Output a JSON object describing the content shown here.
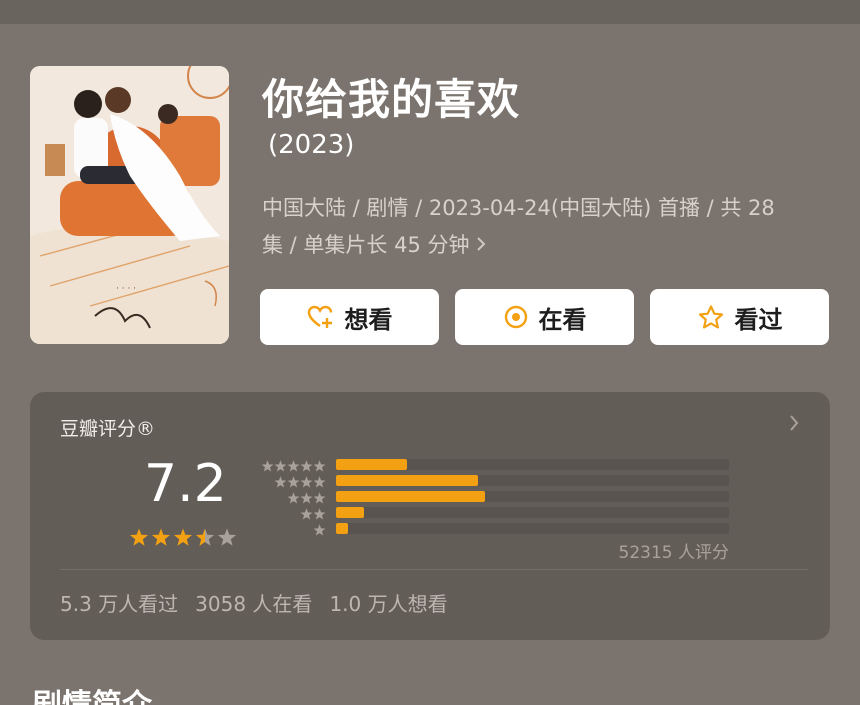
{
  "movie": {
    "title": "你给我的喜欢",
    "year": "(2023)",
    "meta_line1": "中国大陆 / 剧情 / 2023-04-24(中国大陆) 首播 / 共 28",
    "meta_line2": "集 / 单集片长 45 分钟"
  },
  "actions": {
    "want": "想看",
    "watching": "在看",
    "watched": "看过"
  },
  "rating": {
    "label": "豆瓣评分®",
    "score": "7.2",
    "stars_value": 3.5,
    "distribution": [
      {
        "stars": 5,
        "fraction": 0.18
      },
      {
        "stars": 4,
        "fraction": 0.36
      },
      {
        "stars": 3,
        "fraction": 0.38
      },
      {
        "stars": 2,
        "fraction": 0.07
      },
      {
        "stars": 1,
        "fraction": 0.03
      }
    ],
    "count_text": "52315 人评分",
    "stats": [
      "5.3 万人看过",
      "3058 人在看",
      "1.0 万人想看"
    ]
  },
  "section": {
    "heading": "剧情简介"
  },
  "colors": {
    "background": "#7b746e",
    "card": "#635d58",
    "accent": "#f3a112"
  },
  "icons": [
    "heart-plus-icon",
    "target-icon",
    "star-outline-icon",
    "chevron-right-icon",
    "star-icon"
  ]
}
